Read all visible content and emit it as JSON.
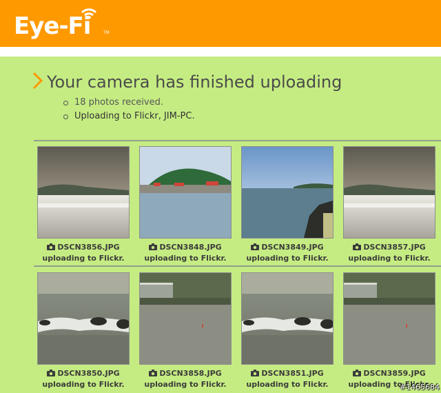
{
  "header": {
    "logo": "Eye-Fi",
    "logo_tm": "TM"
  },
  "title": "Your camera has finished uploading",
  "status": {
    "received": "18 photos received.",
    "uploading": "Uploading to Flickr, JIM-PC."
  },
  "photos": [
    {
      "name": "DSCN3856.JPG",
      "status": "uploading to Flickr.",
      "thumb": "calm-sea-sunset-icon"
    },
    {
      "name": "DSCN3848.JPG",
      "status": "uploading to Flickr.",
      "thumb": "harbor-island-icon"
    },
    {
      "name": "DSCN3849.JPG",
      "status": "uploading to Flickr.",
      "thumb": "blue-sky-coast-icon"
    },
    {
      "name": "DSCN3857.JPG",
      "status": "uploading to Flickr.",
      "thumb": "calm-sea-sunset-icon"
    },
    {
      "name": "DSCN3850.JPG",
      "status": "uploading to Flickr.",
      "thumb": "waves-rocks-icon"
    },
    {
      "name": "DSCN3858.JPG",
      "status": "uploading to Flickr.",
      "thumb": "beach-buildings-icon"
    },
    {
      "name": "DSCN3851.JPG",
      "status": "uploading to Flickr.",
      "thumb": "waves-rocks-icon"
    },
    {
      "name": "DSCN3859.JPG",
      "status": "uploading to Flickr.",
      "thumb": "beach-buildings-icon"
    }
  ],
  "watermark": "#1465684",
  "colors": {
    "header": "#ff9900",
    "background": "#c5ec82",
    "chevron": "#ff9900"
  }
}
